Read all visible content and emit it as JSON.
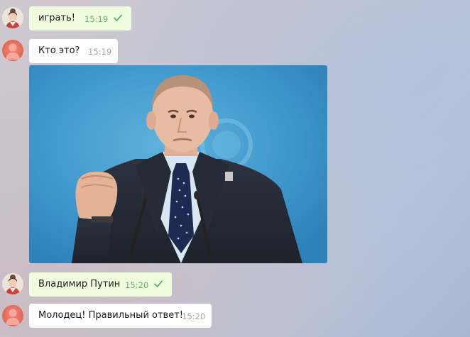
{
  "messages": [
    {
      "sender": "user",
      "text": "играть!",
      "time": "15:19",
      "read_check": "check-icon"
    },
    {
      "sender": "bot",
      "text": "Кто это?",
      "time": "15:19"
    },
    {
      "sender": "bot",
      "type": "photo"
    },
    {
      "sender": "user",
      "text": "Владимир Путин",
      "time": "15:20",
      "read_check": "check-icon"
    },
    {
      "sender": "bot",
      "text": "Молодец! Правильный ответ!",
      "time": "15:20"
    }
  ],
  "colors": {
    "outgoing_bubble": "#effdde",
    "incoming_bubble": "#ffffff",
    "outgoing_time": "#5fb06a",
    "incoming_time": "#a3a3a3",
    "bot_avatar": "#e06654"
  }
}
